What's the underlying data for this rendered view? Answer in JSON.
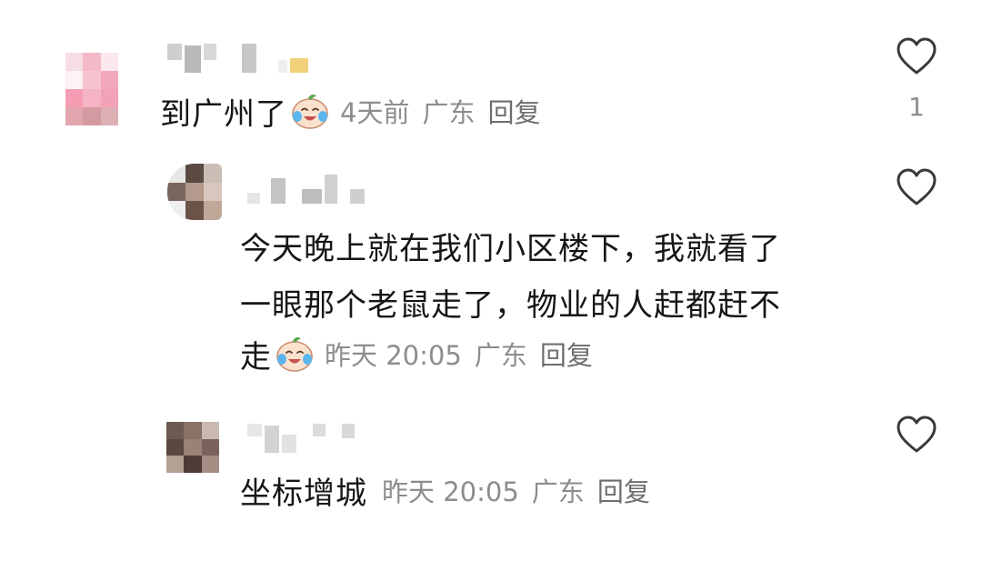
{
  "comments": [
    {
      "text": "到广州了",
      "emoji": "crying-laughing-emoji",
      "time": "4天前",
      "location": "广东",
      "reply_label": "回复",
      "like_count": "1"
    },
    {
      "lines": [
        "今天晚上就在我们小区楼下，我就看了",
        "一眼那个老鼠走了，物业的人赶都赶不",
        "走"
      ],
      "emoji": "crying-laughing-emoji",
      "time": "昨天 20:05",
      "location": "广东",
      "reply_label": "回复"
    },
    {
      "text": "坐标增城",
      "time": "昨天 20:05",
      "location": "广东",
      "reply_label": "回复"
    }
  ],
  "icons": {
    "like": "heart-outline-icon"
  },
  "colors": {
    "text": "#161616",
    "meta": "#8d8d8d",
    "icon": "#3a3a3a"
  }
}
